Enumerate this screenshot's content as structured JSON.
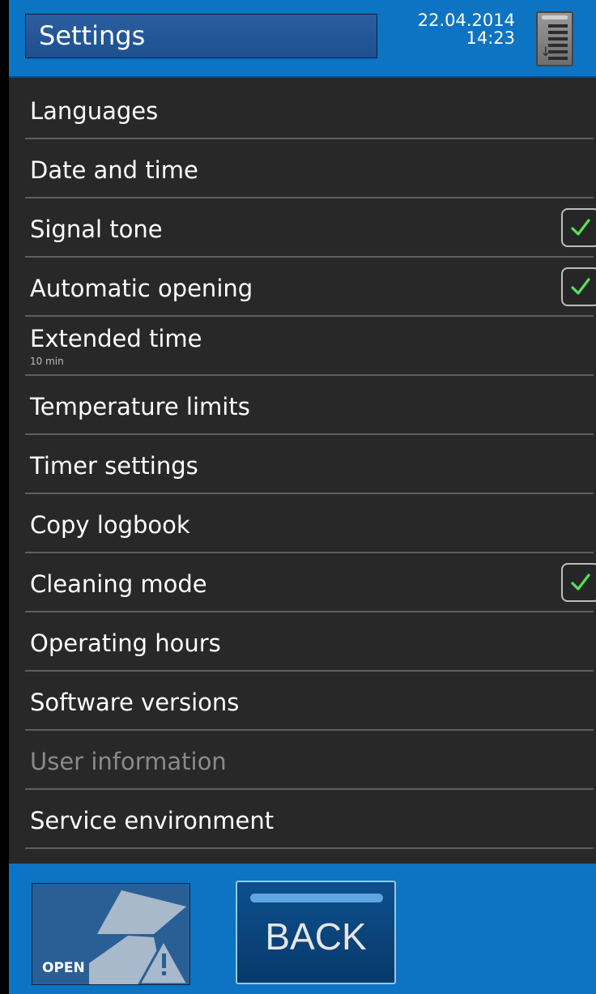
{
  "header": {
    "title": "Settings",
    "date": "22.04.2014",
    "time": "14:23",
    "menu_icon": "list-scroll-icon"
  },
  "settings": {
    "items": [
      {
        "label": "Languages"
      },
      {
        "label": "Date and time"
      },
      {
        "label": "Signal tone",
        "checked": true
      },
      {
        "label": "Automatic opening",
        "checked": true
      },
      {
        "label": "Extended time",
        "sub": "10 min"
      },
      {
        "label": "Temperature limits"
      },
      {
        "label": "Timer settings"
      },
      {
        "label": "Copy logbook"
      },
      {
        "label": "Cleaning mode",
        "checked": true
      },
      {
        "label": "Operating hours"
      },
      {
        "label": "Software versions"
      },
      {
        "label": "User information",
        "disabled": true
      },
      {
        "label": "Service environment"
      }
    ]
  },
  "footer": {
    "open_label": "OPEN",
    "back_label": "BACK"
  },
  "colors": {
    "accent": "#0c74c2",
    "list_bg": "#282828",
    "check": "#58e05a"
  }
}
